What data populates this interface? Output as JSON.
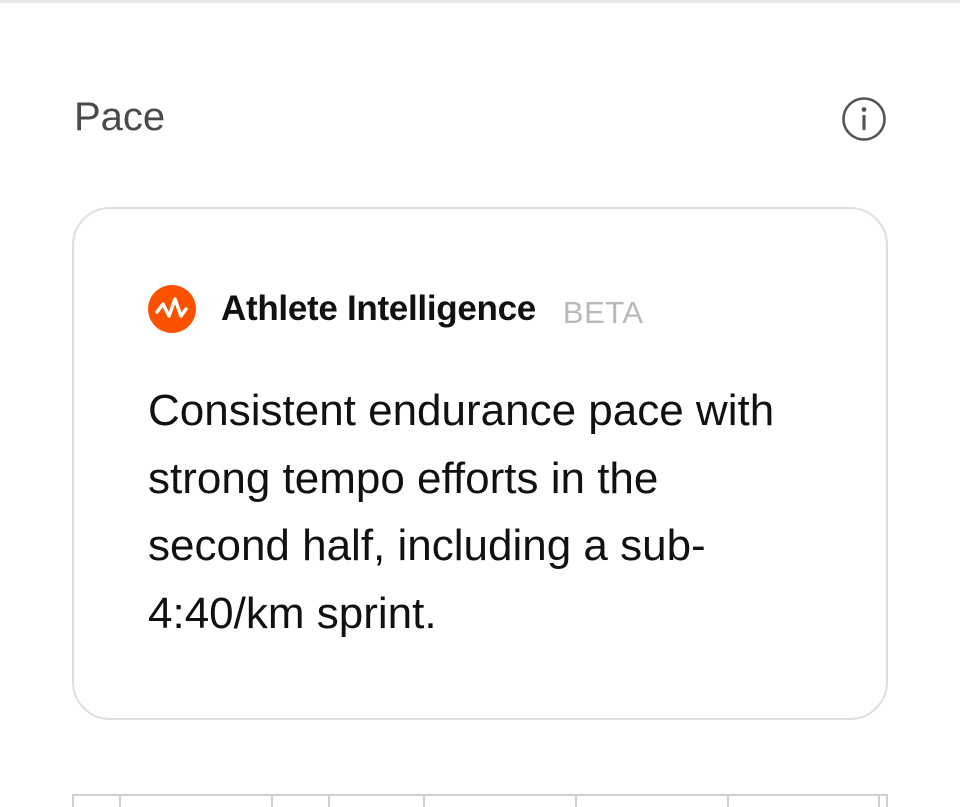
{
  "section": {
    "title": "Pace",
    "info_icon": "info-circle-icon"
  },
  "ai_card": {
    "logo_icon": "strava-logo-icon",
    "logo_color": "#FC5200",
    "brand_name": "Athlete Intelligence",
    "badge": "BETA",
    "summary": "Consistent endurance pace with strong tempo efforts in the second half, including a sub-4:40/km sprint."
  },
  "colors": {
    "title_text": "#4a4a4a",
    "body_text": "#111111",
    "badge_text": "#b9b9b9",
    "card_border": "#dedede"
  }
}
